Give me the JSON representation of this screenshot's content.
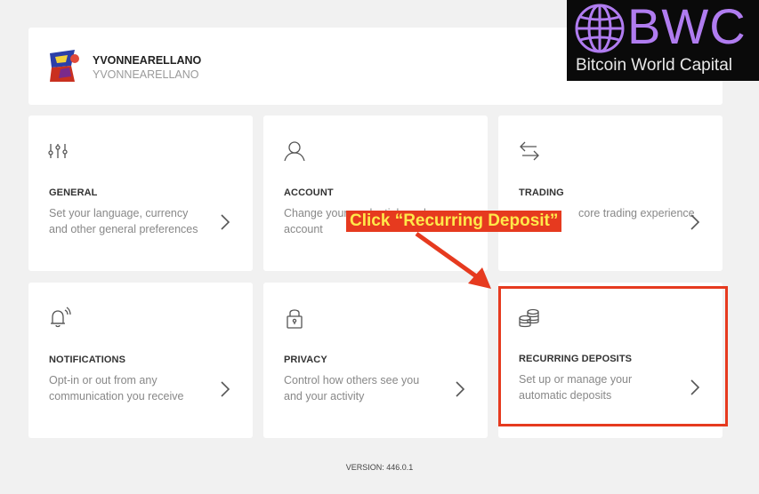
{
  "profile": {
    "name": "YVONNEARELLANO",
    "handle": "YVONNEARELLANO"
  },
  "cards": [
    {
      "key": "general",
      "icon": "sliders-icon",
      "title": "GENERAL",
      "desc": "Set your language, currency and other general preferences"
    },
    {
      "key": "account",
      "icon": "user-icon",
      "title": "ACCOUNT",
      "desc": "Change your credentials and account"
    },
    {
      "key": "trading",
      "icon": "swap-arrows-icon",
      "title": "TRADING",
      "desc": "core trading experience"
    },
    {
      "key": "notifications",
      "icon": "bell-icon",
      "title": "NOTIFICATIONS",
      "desc": "Opt-in or out from any communication you receive"
    },
    {
      "key": "privacy",
      "icon": "lock-icon",
      "title": "PRIVACY",
      "desc": "Control how others see you and your activity"
    },
    {
      "key": "recurring-deposits",
      "icon": "coins-icon",
      "title": "RECURRING DEPOSITS",
      "desc": "Set up or manage your automatic deposits"
    }
  ],
  "version": "VERSION: 446.0.1",
  "annotation": {
    "callout": "Click “Recurring Deposit”",
    "color": "#e63a1f",
    "text_color": "#ffe94a"
  },
  "logo": {
    "brand": "BWC",
    "tagline": "Bitcoin World Capital",
    "color": "#b07cf0"
  }
}
